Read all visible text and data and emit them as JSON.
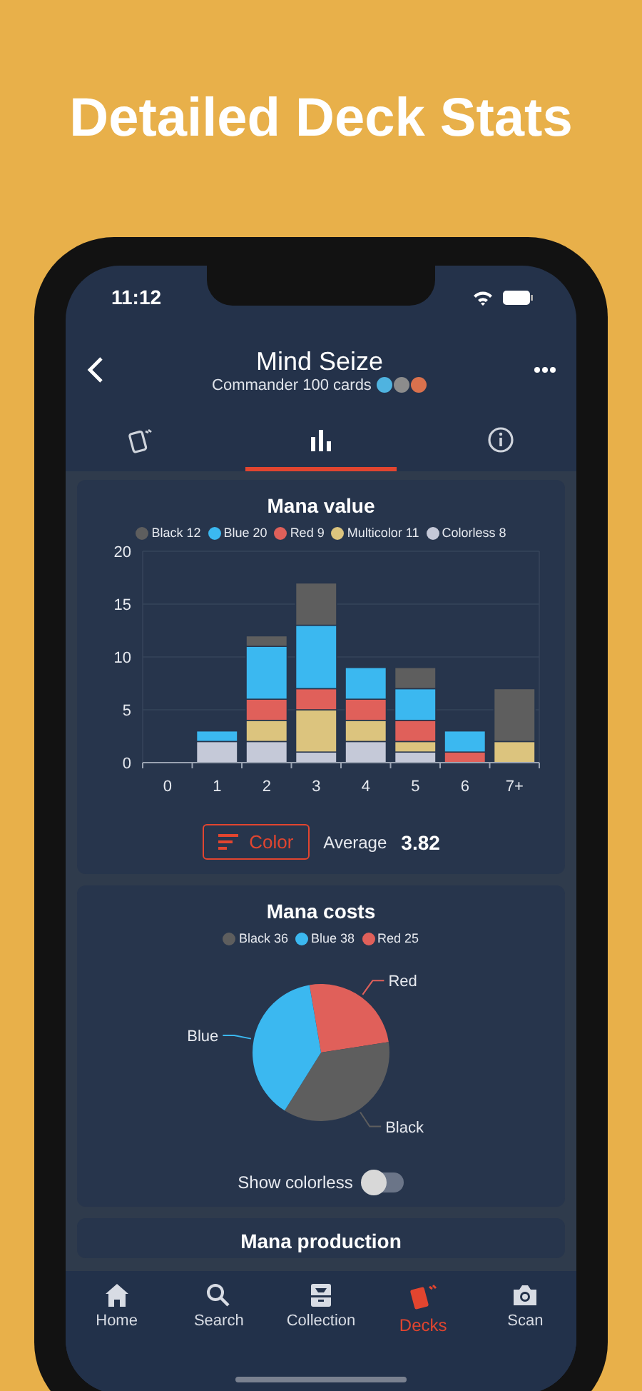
{
  "headline": "Detailed Deck Stats",
  "status_bar": {
    "time": "11:12"
  },
  "header": {
    "title": "Mind Seize",
    "subtitle": "Commander 100 cards",
    "color_identity": [
      {
        "color": "#4fb3e0"
      },
      {
        "color": "#8c8c8c"
      },
      {
        "color": "#d9714d"
      }
    ]
  },
  "tabs": [
    {
      "kind": "cards",
      "selected": false
    },
    {
      "kind": "stats",
      "selected": true
    },
    {
      "kind": "info",
      "selected": false
    }
  ],
  "mana_value": {
    "title": "Mana value",
    "legend": [
      {
        "label": "Black 12",
        "color": "#5e5e5e"
      },
      {
        "label": "Blue 20",
        "color": "#3bb8f0"
      },
      {
        "label": "Red 9",
        "color": "#e0605a"
      },
      {
        "label": "Multicolor 11",
        "color": "#dcc47e"
      },
      {
        "label": "Colorless 8",
        "color": "#c5c9d8"
      }
    ],
    "chart_data": {
      "type": "bar",
      "stacked": true,
      "grid": true,
      "categories": [
        "0",
        "1",
        "2",
        "3",
        "4",
        "5",
        "6",
        "7+"
      ],
      "ylim": [
        0,
        20
      ],
      "yticks": [
        0,
        5,
        10,
        15,
        20
      ],
      "series": [
        {
          "color": "#c5c9d8",
          "values": [
            0,
            2,
            2,
            1,
            2,
            1,
            0,
            0
          ]
        },
        {
          "color": "#dcc47e",
          "values": [
            0,
            0,
            2,
            4,
            2,
            1,
            0,
            2
          ]
        },
        {
          "color": "#e0605a",
          "values": [
            0,
            0,
            2,
            2,
            2,
            2,
            1,
            0
          ]
        },
        {
          "color": "#3bb8f0",
          "values": [
            0,
            1,
            5,
            6,
            3,
            3,
            2,
            0
          ]
        },
        {
          "color": "#5e5e5e",
          "values": [
            0,
            0,
            1,
            4,
            0,
            2,
            0,
            5
          ]
        }
      ]
    },
    "sort_button": "Color",
    "average_label": "Average",
    "average_value": "3.82"
  },
  "mana_costs": {
    "title": "Mana costs",
    "legend": [
      {
        "label": "Black 36",
        "color": "#5e5e5e"
      },
      {
        "label": "Blue 38",
        "color": "#3bb8f0"
      },
      {
        "label": "Red 25",
        "color": "#e0605a"
      }
    ],
    "chart_data": {
      "type": "pie",
      "categories": [
        "Black",
        "Blue",
        "Red"
      ],
      "values": [
        36,
        38,
        25
      ]
    },
    "toggle_label": "Show colorless",
    "toggle_on": false
  },
  "next_section": {
    "title": "Mana production"
  },
  "bottom_nav": [
    {
      "kind": "home",
      "label": "Home",
      "selected": false
    },
    {
      "kind": "search",
      "label": "Search",
      "selected": false
    },
    {
      "kind": "collection",
      "label": "Collection",
      "selected": false
    },
    {
      "kind": "decks",
      "label": "Decks",
      "selected": true
    },
    {
      "kind": "scan",
      "label": "Scan",
      "selected": false
    }
  ]
}
